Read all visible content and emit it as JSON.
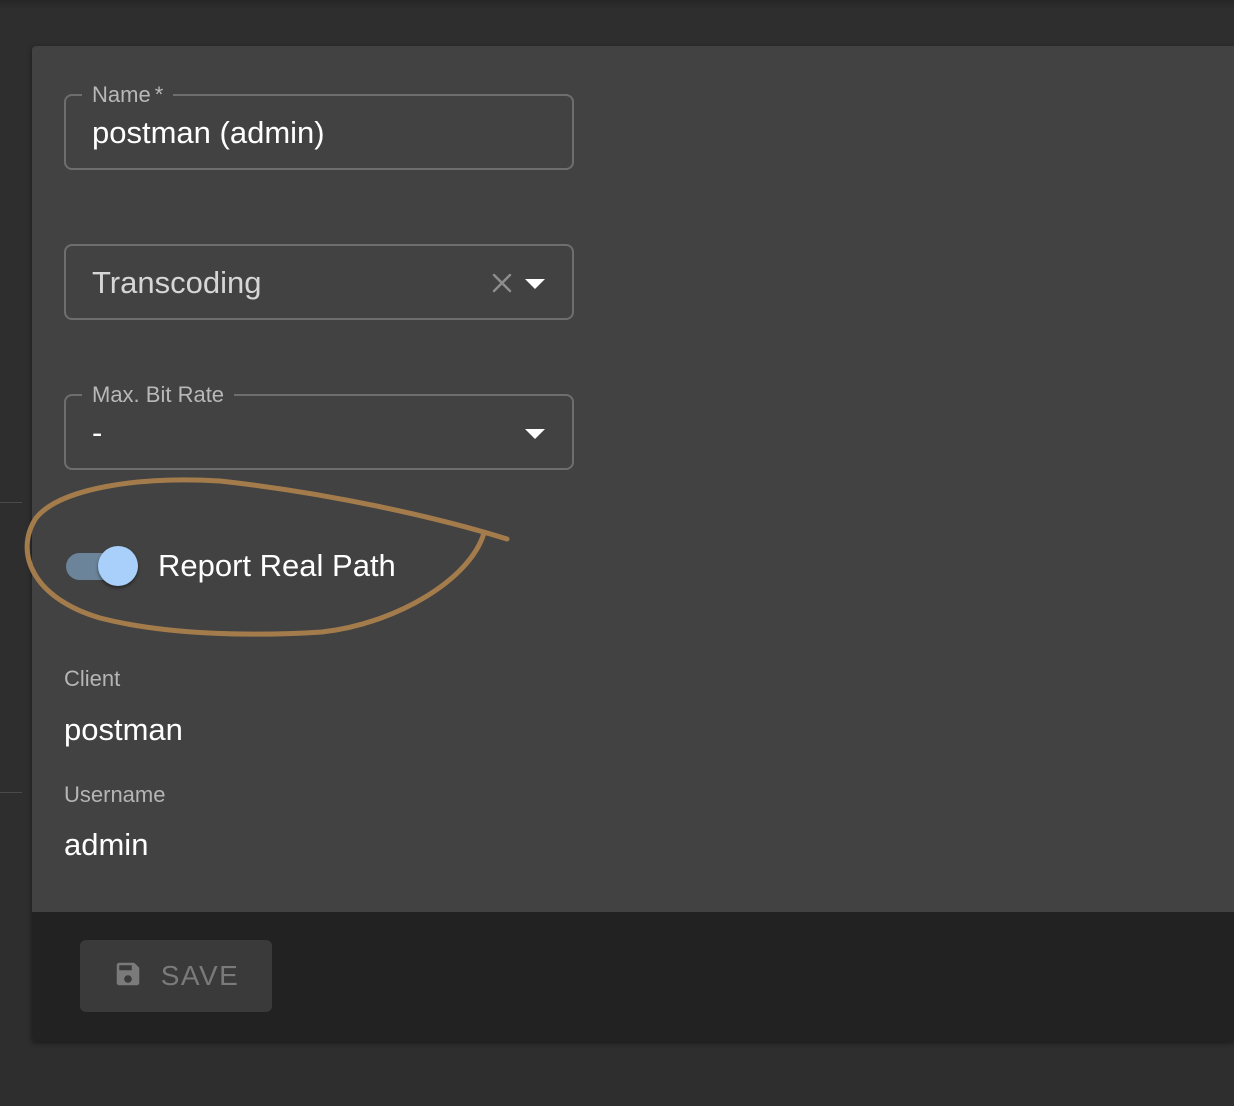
{
  "form": {
    "name_field": {
      "label": "Name",
      "required_marker": "*",
      "value": "postman (admin)"
    },
    "transcoding_field": {
      "placeholder": "Transcoding",
      "clear_icon": "close-icon",
      "dropdown_icon": "arrow-drop-down-icon"
    },
    "max_bit_rate_field": {
      "label": "Max. Bit Rate",
      "value": "-",
      "dropdown_icon": "arrow-drop-down-icon"
    },
    "report_real_path": {
      "label": "Report Real Path",
      "checked": true
    }
  },
  "info": {
    "client": {
      "label": "Client",
      "value": "postman"
    },
    "username": {
      "label": "Username",
      "value": "admin"
    }
  },
  "toolbar": {
    "save_label": "SAVE",
    "save_icon": "floppy-disk-icon",
    "save_disabled": true
  },
  "colors": {
    "page_bg": "#2e2e2e",
    "card_bg": "#424242",
    "toolbar_bg": "#222222",
    "switch_thumb": "#a8d0fb",
    "switch_track": "#6b8499",
    "highlight_stroke": "#a47c4c"
  }
}
